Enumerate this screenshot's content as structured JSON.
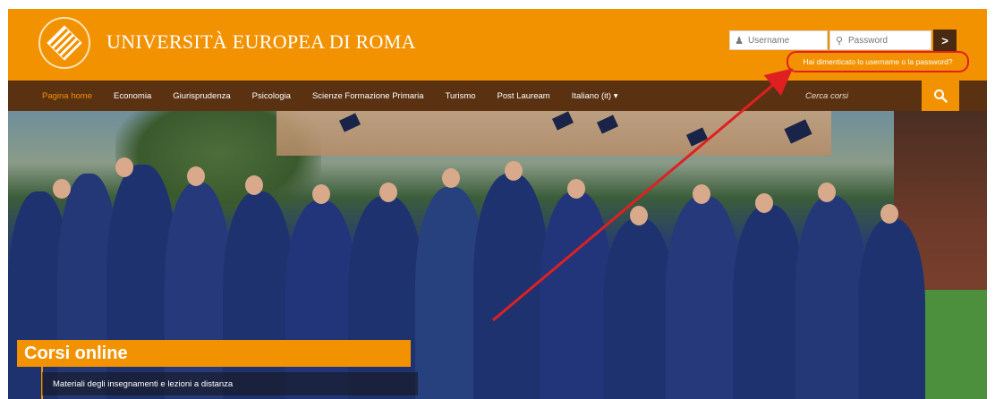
{
  "header": {
    "brand": "UNIVERSITÀ EUROPEA DI ROMA",
    "login": {
      "username_placeholder": "Username",
      "password_placeholder": "Password",
      "submit_label": ">",
      "forgot_link": "Hai dimenticato lo username o la password?"
    }
  },
  "nav": {
    "items": [
      {
        "label": "Pagina home",
        "active": true
      },
      {
        "label": "Economia"
      },
      {
        "label": "Giurisprudenza"
      },
      {
        "label": "Psicologia"
      },
      {
        "label": "Scienze Formazione Primaria"
      },
      {
        "label": "Turismo"
      },
      {
        "label": "Post Lauream"
      },
      {
        "label": "Italiano (it) ▾"
      }
    ],
    "search_placeholder": "Cerca corsi",
    "search_icon": "search-icon"
  },
  "hero": {
    "title": "Corsi online",
    "subtitle": "Materiali degli insegnamenti e lezioni a distanza"
  },
  "colors": {
    "brand_orange": "#f39200",
    "nav_brown": "#5a3212",
    "annotation_red": "#e02020"
  }
}
